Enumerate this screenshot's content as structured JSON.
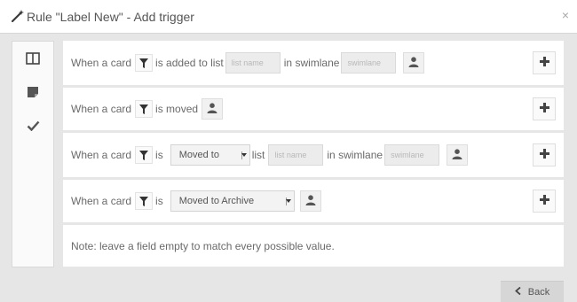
{
  "dialog": {
    "title": "Rule \"Label New\" - Add trigger",
    "close_label": "×"
  },
  "tabs": [
    {
      "icon": "columns-icon"
    },
    {
      "icon": "card-icon"
    },
    {
      "icon": "check-icon"
    }
  ],
  "triggers": {
    "row1": {
      "prefix": "When a card",
      "action": "is added to list",
      "list_placeholder": "list name",
      "swimlane_label": "in swimlane",
      "swimlane_placeholder": "swimlane"
    },
    "row2": {
      "prefix": "When a card",
      "action": "is moved"
    },
    "row3": {
      "prefix": "When a card",
      "action": "is",
      "select_value": "Moved to",
      "list_label": "list",
      "list_placeholder": "list name",
      "swimlane_label": "in swimlane",
      "swimlane_placeholder": "swimlane"
    },
    "row4": {
      "prefix": "When a card",
      "action": "is",
      "select_value": "Moved to Archive"
    }
  },
  "note": "Note: leave a field empty to match every possible value.",
  "footer": {
    "back_label": "Back",
    "back_icon": "chevron-left-icon"
  },
  "colors": {
    "background": "#e6e6e6",
    "panel": "#ffffff",
    "text": "#6a6a6a"
  }
}
